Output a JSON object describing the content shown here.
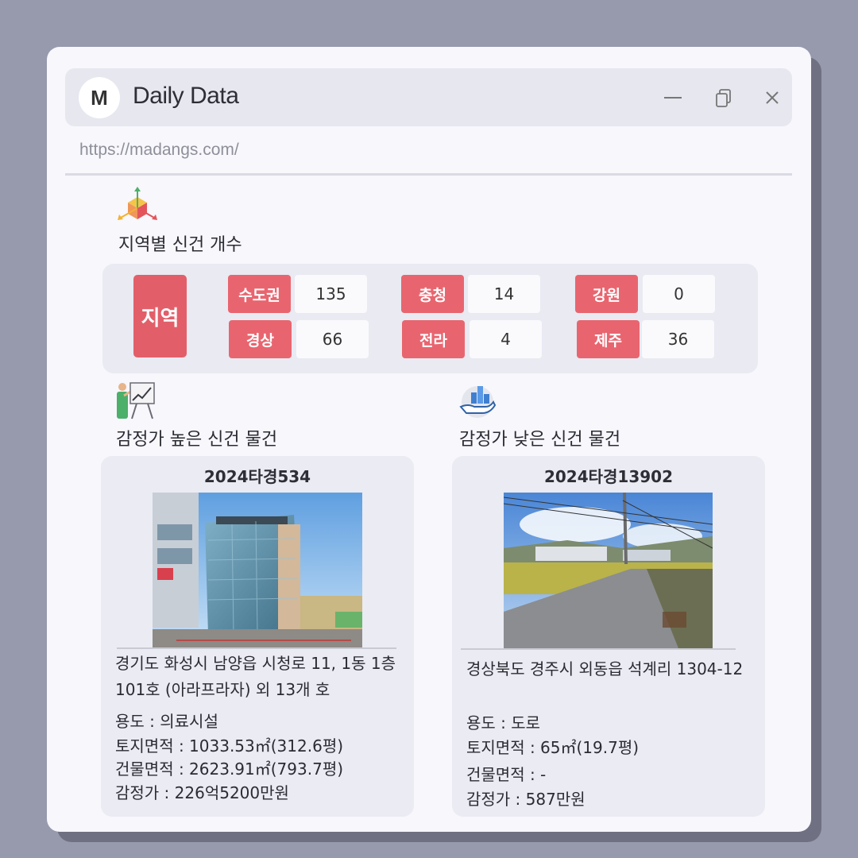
{
  "window": {
    "avatar_letter": "M",
    "title": "Daily Data",
    "url": "https://madangs.com/"
  },
  "icons": {
    "minimize": "minimize-icon",
    "restore": "restore-icon",
    "close": "close-icon",
    "axes": "3d-axes-icon",
    "presentation": "presentation-chart-icon",
    "hand_chart": "hand-bar-chart-icon"
  },
  "colors": {
    "accent": "#e8656f",
    "panel": "#e9eaf2",
    "background": "#979aad"
  },
  "regions": {
    "section_title": "지역별 신건 개수",
    "label": "지역",
    "items": [
      {
        "name": "수도권",
        "count": "135"
      },
      {
        "name": "충청",
        "count": "14"
      },
      {
        "name": "강원",
        "count": "0"
      },
      {
        "name": "경상",
        "count": "66"
      },
      {
        "name": "전라",
        "count": "4"
      },
      {
        "name": "제주",
        "count": "36"
      }
    ]
  },
  "high": {
    "section_title": "감정가 높은 신건 물건",
    "case_no": "2024타경534",
    "address_line1": "경기도 화성시 남양읍 시청로 11, 1동 1층",
    "address_line2": "101호 (아라프라자) 외 13개 호",
    "usage": "용도 : 의료시설",
    "land_area": "토지면적 : 1033.53㎡(312.6평)",
    "building_area": "건물면적 : 2623.91㎡(793.7평)",
    "appraisal": "감정가 : 226억5200만원"
  },
  "low": {
    "section_title": "감정가 낮은 신건 물건",
    "case_no": "2024타경13902",
    "address_line1": "경상북도 경주시 외동읍 석계리 1304-12",
    "usage": "용도 : 도로",
    "land_area": "토지면적 : 65㎡(19.7평)",
    "building_area": "건물면적 : -",
    "appraisal": "감정가 : 587만원"
  }
}
